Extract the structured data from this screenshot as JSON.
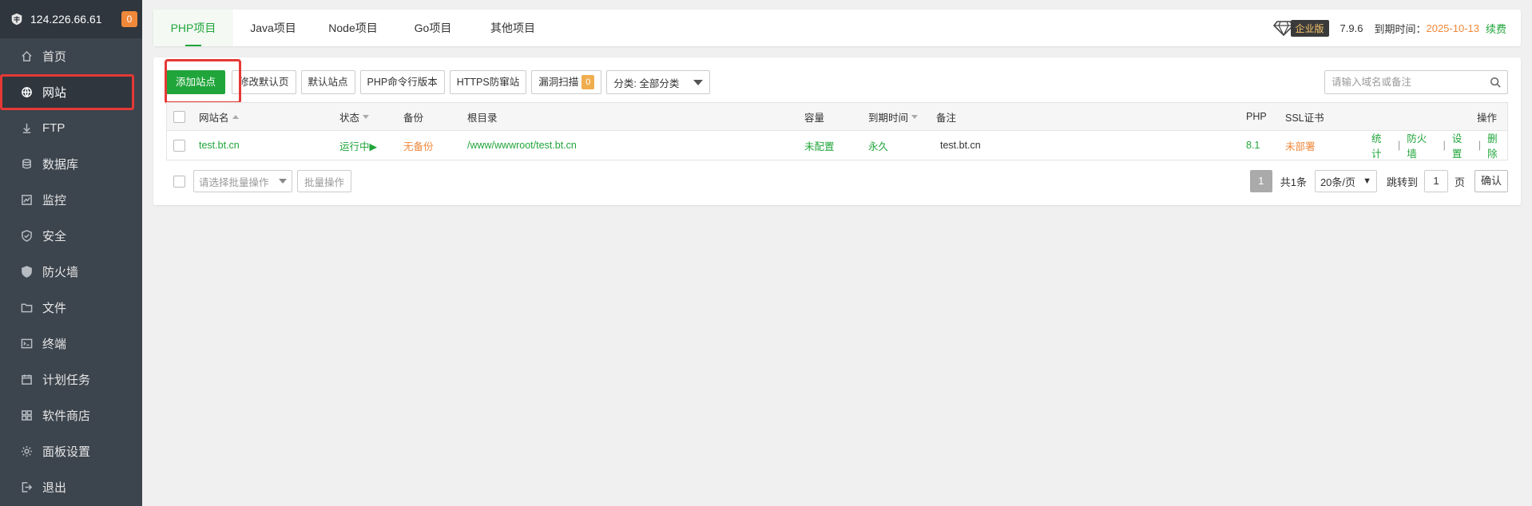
{
  "sidebar": {
    "ip": "124.226.66.61",
    "badge": "0",
    "items": [
      {
        "label": "首页",
        "icon": "home-icon"
      },
      {
        "label": "网站",
        "icon": "globe-icon"
      },
      {
        "label": "FTP",
        "icon": "ftp-icon"
      },
      {
        "label": "数据库",
        "icon": "database-icon"
      },
      {
        "label": "监控",
        "icon": "monitor-icon"
      },
      {
        "label": "安全",
        "icon": "shield-icon"
      },
      {
        "label": "防火墙",
        "icon": "firewall-icon"
      },
      {
        "label": "文件",
        "icon": "folder-icon"
      },
      {
        "label": "终端",
        "icon": "terminal-icon"
      },
      {
        "label": "计划任务",
        "icon": "calendar-icon"
      },
      {
        "label": "软件商店",
        "icon": "grid-icon"
      },
      {
        "label": "面板设置",
        "icon": "gear-icon"
      },
      {
        "label": "退出",
        "icon": "logout-icon"
      }
    ]
  },
  "topbar": {
    "tabs": [
      "PHP项目",
      "Java项目",
      "Node项目",
      "Go项目",
      "其他项目"
    ],
    "edition": "企业版",
    "version": "7.9.6",
    "expire_label": "到期时间：",
    "expire_date": "2025-10-13",
    "renew": "续费"
  },
  "toolbar": {
    "add_site": "添加站点",
    "edit_default": "修改默认页",
    "default_site": "默认站点",
    "php_cli": "PHP命令行版本",
    "https_guard": "HTTPS防窜站",
    "vuln_scan": "漏洞扫描",
    "vuln_count": "0",
    "category": "分类: 全部分类",
    "search_placeholder": "请输入域名或备注"
  },
  "table": {
    "headers": {
      "name": "网站名",
      "status": "状态",
      "backup": "备份",
      "root": "根目录",
      "quota": "容量",
      "expire": "到期时间",
      "remark": "备注",
      "php": "PHP",
      "ssl": "SSL证书",
      "ops": "操作"
    },
    "rows": [
      {
        "name": "test.bt.cn",
        "status": "运行中▶",
        "backup": "无备份",
        "root": "/www/wwwroot/test.bt.cn",
        "quota": "未配置",
        "expire": "永久",
        "remark": "test.bt.cn",
        "php": "8.1",
        "ssl": "未部署",
        "ops": [
          "统计",
          "防火墙",
          "设置",
          "删除"
        ]
      }
    ]
  },
  "footer": {
    "batch_placeholder": "请选择批量操作",
    "batch_button": "批量操作",
    "current_page": "1",
    "total": "共1条",
    "page_size": "20条/页",
    "jump_label": "跳转到",
    "jump_value": "1",
    "page_unit": "页",
    "confirm": "确认"
  }
}
